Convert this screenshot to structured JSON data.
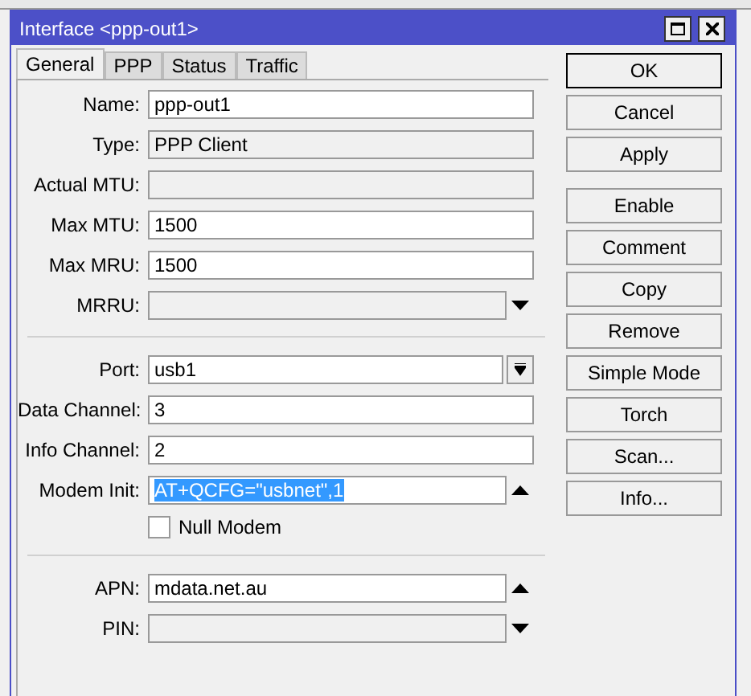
{
  "window": {
    "title": "Interface <ppp-out1>"
  },
  "tabs": [
    {
      "label": "General",
      "selected": true
    },
    {
      "label": "PPP",
      "selected": false
    },
    {
      "label": "Status",
      "selected": false
    },
    {
      "label": "Traffic",
      "selected": false
    }
  ],
  "sections": [
    {
      "fields": [
        {
          "kind": "text",
          "label": "Name:",
          "value": "ppp-out1",
          "disabled": false
        },
        {
          "kind": "text",
          "label": "Type:",
          "value": "PPP Client",
          "disabled": true
        },
        {
          "kind": "text",
          "label": "Actual MTU:",
          "disabled": true
        },
        {
          "kind": "text",
          "label": "Max MTU:",
          "value": "1500",
          "disabled": false
        },
        {
          "kind": "text",
          "label": "Max MRU:",
          "value": "1500",
          "disabled": false
        },
        {
          "kind": "toggle",
          "label": "MRRU:",
          "disabled": true,
          "expanded": false
        }
      ]
    },
    {
      "fields": [
        {
          "kind": "dropdown",
          "label": "Port:",
          "value": "usb1",
          "disabled": false
        },
        {
          "kind": "text",
          "label": "Data Channel:",
          "value": "3",
          "disabled": false
        },
        {
          "kind": "text",
          "label": "Info Channel:",
          "value": "2",
          "disabled": false
        },
        {
          "kind": "toggle",
          "label": "Modem Init:",
          "value": "AT+QCFG=\"usbnet\",1",
          "disabled": false,
          "expanded": true,
          "selected": true
        },
        {
          "kind": "checkbox",
          "label": "Null Modem",
          "checked": false
        }
      ]
    },
    {
      "fields": [
        {
          "kind": "toggle",
          "label": "APN:",
          "value": "mdata.net.au",
          "disabled": false,
          "expanded": true
        },
        {
          "kind": "toggle",
          "label": "PIN:",
          "disabled": true,
          "expanded": false
        }
      ]
    }
  ],
  "buttons": [
    {
      "label": "OK",
      "default": true
    },
    {
      "label": "Cancel",
      "default": false
    },
    {
      "label": "Apply",
      "default": false
    },
    {
      "label": "Enable",
      "default": false
    },
    {
      "label": "Comment",
      "default": false
    },
    {
      "label": "Copy",
      "default": false
    },
    {
      "label": "Remove",
      "default": false
    },
    {
      "label": "Simple Mode",
      "default": false
    },
    {
      "label": "Torch",
      "default": false
    },
    {
      "label": "Scan...",
      "default": false
    },
    {
      "label": "Info...",
      "default": false
    }
  ]
}
